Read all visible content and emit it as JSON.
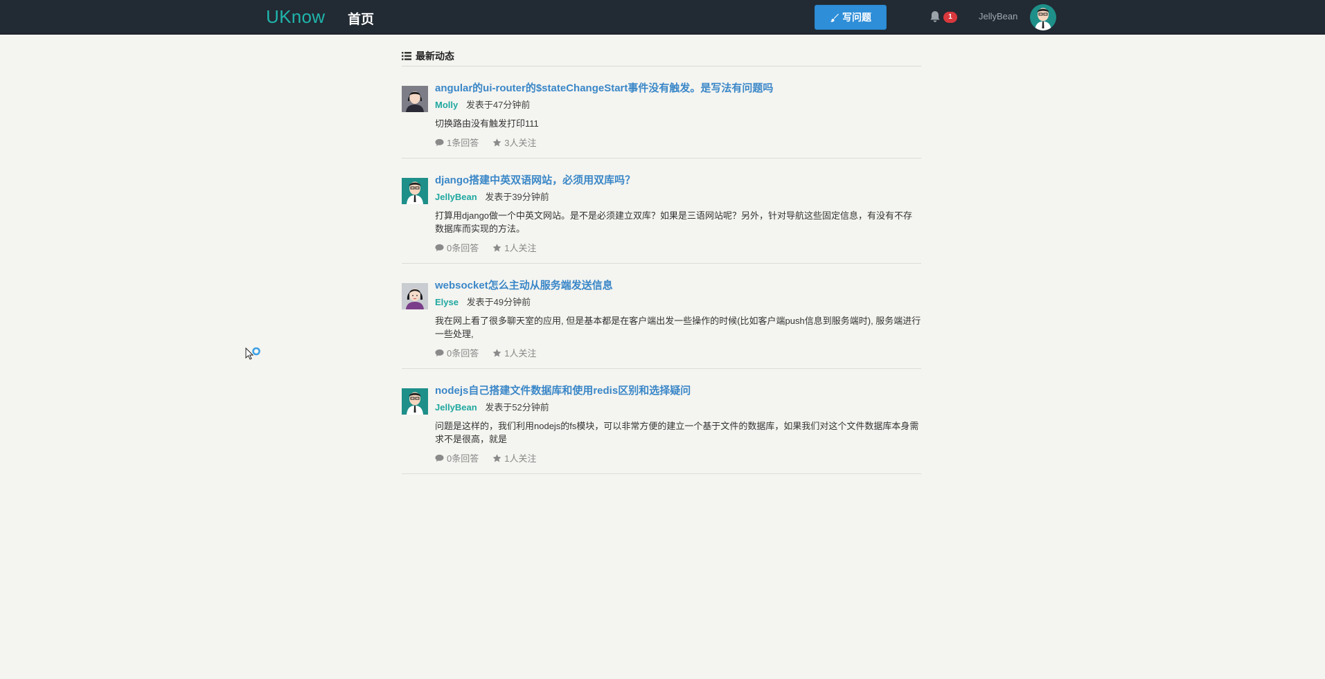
{
  "navbar": {
    "brand": "UKnow",
    "home_label": "首页",
    "ask_label": "写问题",
    "notification_count": "1",
    "username": "JellyBean",
    "accent": "#1fb5ac",
    "button_color": "#2e8ed8"
  },
  "feed": {
    "heading": "最新动态",
    "items": [
      {
        "title": "angular的ui-router的$stateChangeStart事件没有触发。是写法有问题吗",
        "author": "Molly",
        "time": "发表于47分钟前",
        "excerpt": "切换路由没有触发打印111",
        "answers": "1条回答",
        "follows": "3人关注",
        "avatar_icon": "female-avatar-icon"
      },
      {
        "title": "django搭建中英双语网站，必须用双库吗？",
        "author": "JellyBean",
        "time": "发表于39分钟前",
        "excerpt": "打算用django做一个中英文网站。是不是必须建立双库？如果是三语网站呢？另外，针对导航这些固定信息，有没有不存数据库而实现的方法。",
        "answers": "0条回答",
        "follows": "1人关注",
        "avatar_icon": "male-avatar-icon"
      },
      {
        "title": "websocket怎么主动从服务端发送信息",
        "author": "Elyse",
        "time": "发表于49分钟前",
        "excerpt": "我在网上看了很多聊天室的应用, 但是基本都是在客户端出发一些操作的时候(比如客户端push信息到服务端时), 服务端进行一些处理,",
        "answers": "0条回答",
        "follows": "1人关注",
        "avatar_icon": "female-avatar-icon"
      },
      {
        "title": "nodejs自己搭建文件数据库和使用redis区别和选择疑问",
        "author": "JellyBean",
        "time": "发表于52分钟前",
        "excerpt": "问题是这样的，我们利用nodejs的fs模块，可以非常方便的建立一个基于文件的数据库，如果我们对这个文件数据库本身需求不是很高，就是",
        "answers": "0条回答",
        "follows": "1人关注",
        "avatar_icon": "male-avatar-icon"
      }
    ]
  }
}
